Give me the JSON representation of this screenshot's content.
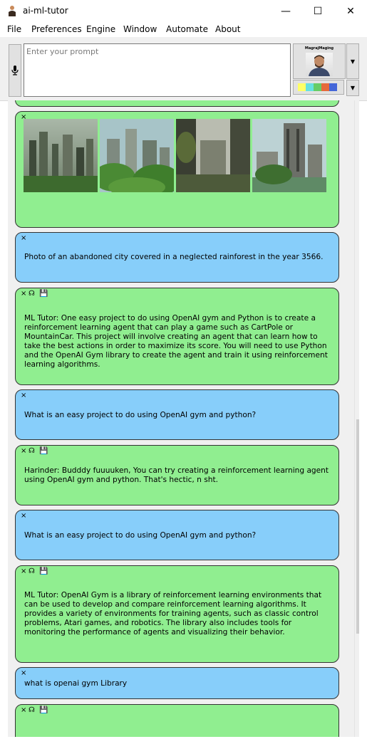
{
  "window": {
    "title": "ai-ml-tutor",
    "minimize_glyph": "—",
    "maximize_glyph": "☐",
    "close_glyph": "✕"
  },
  "menu": [
    "File",
    "Preferences",
    "Engine",
    "Window",
    "Automate",
    "About"
  ],
  "prompt": {
    "placeholder": "Enter your prompt"
  },
  "avatar": {
    "label": "MagrajMaging"
  },
  "swatch_colors": [
    "#ffff66",
    "#66e0e0",
    "#66cc66",
    "#e66a3c",
    "#4466d8"
  ],
  "glyphs": {
    "close": "×",
    "speak": "☊",
    "save": "💾",
    "dropdown": "▼",
    "scroll_up": "⌃",
    "scroll_down": "⌄"
  },
  "messages": [
    {
      "type": "image",
      "icons": [
        "close"
      ]
    },
    {
      "type": "user",
      "icons": [
        "close"
      ],
      "text": "Photo of an abandoned city covered in a neglected rainforest in the year 3566."
    },
    {
      "type": "bot",
      "icons": [
        "close",
        "speak",
        "save"
      ],
      "text": "ML Tutor: One easy project to do using OpenAI gym and Python is to create a reinforcement learning agent that can play a game such as CartPole or MountainCar. This project will involve creating an agent that can learn how to take the best actions in order to maximize its score. You will need to use Python and the OpenAI Gym library to create the agent and train it using reinforcement learning algorithms."
    },
    {
      "type": "user",
      "icons": [
        "close"
      ],
      "text": "What is an easy project to do using OpenAI gym and python?"
    },
    {
      "type": "bot",
      "icons": [
        "close",
        "speak",
        "save"
      ],
      "text": "Harinder: Budddy fuuuuken, You can try creating a reinforcement learning agent using OpenAI gym and python. That's hectic, n sht."
    },
    {
      "type": "user",
      "icons": [
        "close"
      ],
      "text": "What is an easy project to do using OpenAI gym and python?"
    },
    {
      "type": "bot",
      "icons": [
        "close",
        "speak",
        "save"
      ],
      "text": "ML Tutor: OpenAI Gym is a library of reinforcement learning environments that can be used to develop and compare reinforcement learning algorithms. It provides a variety of environments for training agents, such as classic control problems, Atari games, and robotics. The library also includes tools for monitoring the performance of agents and visualizing their behavior."
    },
    {
      "type": "user",
      "icons": [
        "close"
      ],
      "text": "what is openai gym Library"
    },
    {
      "type": "bot",
      "icons": [
        "close",
        "speak",
        "save"
      ],
      "text": ""
    }
  ]
}
